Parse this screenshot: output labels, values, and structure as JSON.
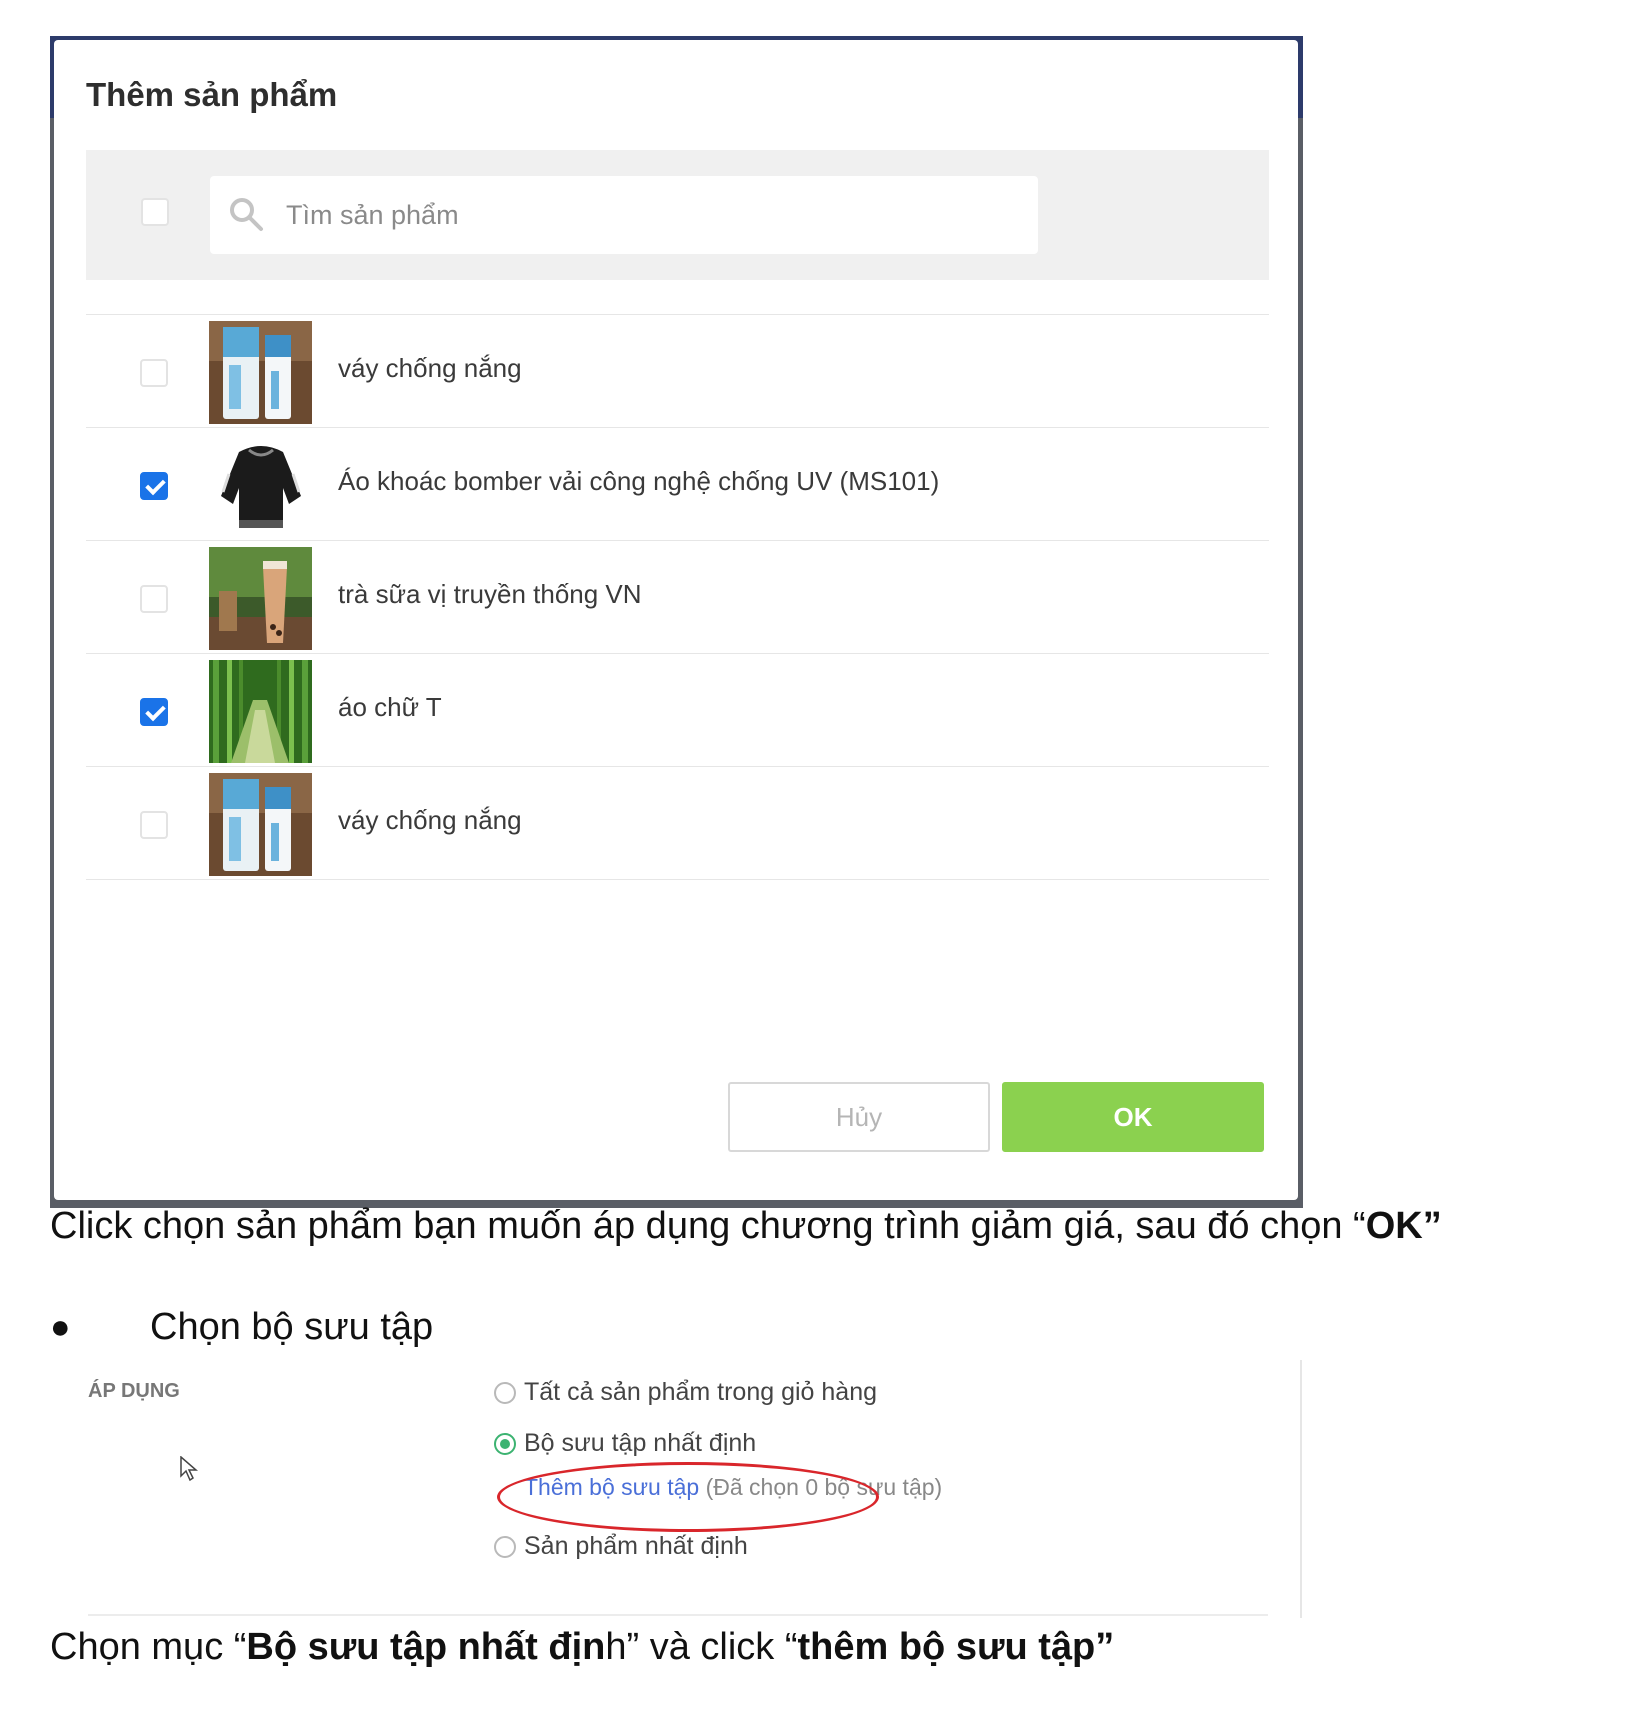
{
  "modal": {
    "title": "Thêm sản phẩm",
    "search_placeholder": "Tìm sản phẩm",
    "products": [
      {
        "name": "váy chống nắng",
        "checked": false,
        "thumbnail": "sunscreen-tubes"
      },
      {
        "name": "Áo khoác bomber vải công nghệ chống UV (MS101)",
        "checked": true,
        "thumbnail": "black-bomber-jacket"
      },
      {
        "name": "trà sữa vị truyền thống VN",
        "checked": false,
        "thumbnail": "milk-tea-cup"
      },
      {
        "name": "áo chữ T",
        "checked": true,
        "thumbnail": "bamboo-forest"
      },
      {
        "name": "váy chống nắng",
        "checked": false,
        "thumbnail": "sunscreen-tubes"
      }
    ],
    "cancel_label": "Hủy",
    "ok_label": "OK",
    "colors": {
      "ok_green": "#8bd14f",
      "checkbox_blue": "#1a73e8",
      "header_navy": "#2d3b6b"
    }
  },
  "doc": {
    "caption1_before": "Click chọn sản phẩm bạn muốn áp dụng chương trình giảm giá, sau đó chọn “",
    "caption1_bold": "OK”",
    "bullet": "●",
    "bullet_text": "Chọn bộ sưu tập",
    "caption2_a": "Chọn mục “",
    "caption2_b": "Bộ sưu tập nhất địn",
    "caption2_c": "h” và click “",
    "caption2_d": "thêm bộ sưu tập”"
  },
  "apply": {
    "label": "ÁP DỤNG",
    "options": [
      {
        "label": "Tất cả sản phẩm trong giỏ hàng",
        "selected": false
      },
      {
        "label": "Bộ sưu tập nhất định",
        "selected": true
      },
      {
        "label": "Sản phẩm nhất định",
        "selected": false
      }
    ],
    "add_collection_link": "Thêm bộ sưu tập",
    "selected_count_text": "(Đã chọn 0 bộ sưu tập)",
    "highlight_color": "#d9262b"
  }
}
